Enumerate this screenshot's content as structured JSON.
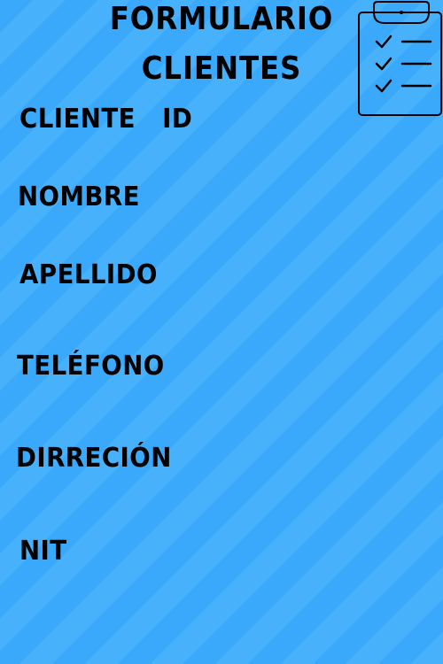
{
  "form": {
    "title_line_1": "FORMULARIO",
    "title_line_2": "CLIENTES",
    "fields": [
      {
        "label": "CLIENTE   ID"
      },
      {
        "label": "NOMBRE"
      },
      {
        "label": "APELLIDO"
      },
      {
        "label": "TELÉFONO"
      },
      {
        "label": "DIRRECIÓN"
      },
      {
        "label": "NIT"
      }
    ]
  },
  "icons": {
    "clipboard": "clipboard-checklist-icon"
  },
  "colors": {
    "background": "#3aa9fb",
    "stripe": "#47b1fc",
    "text": "#000000"
  }
}
